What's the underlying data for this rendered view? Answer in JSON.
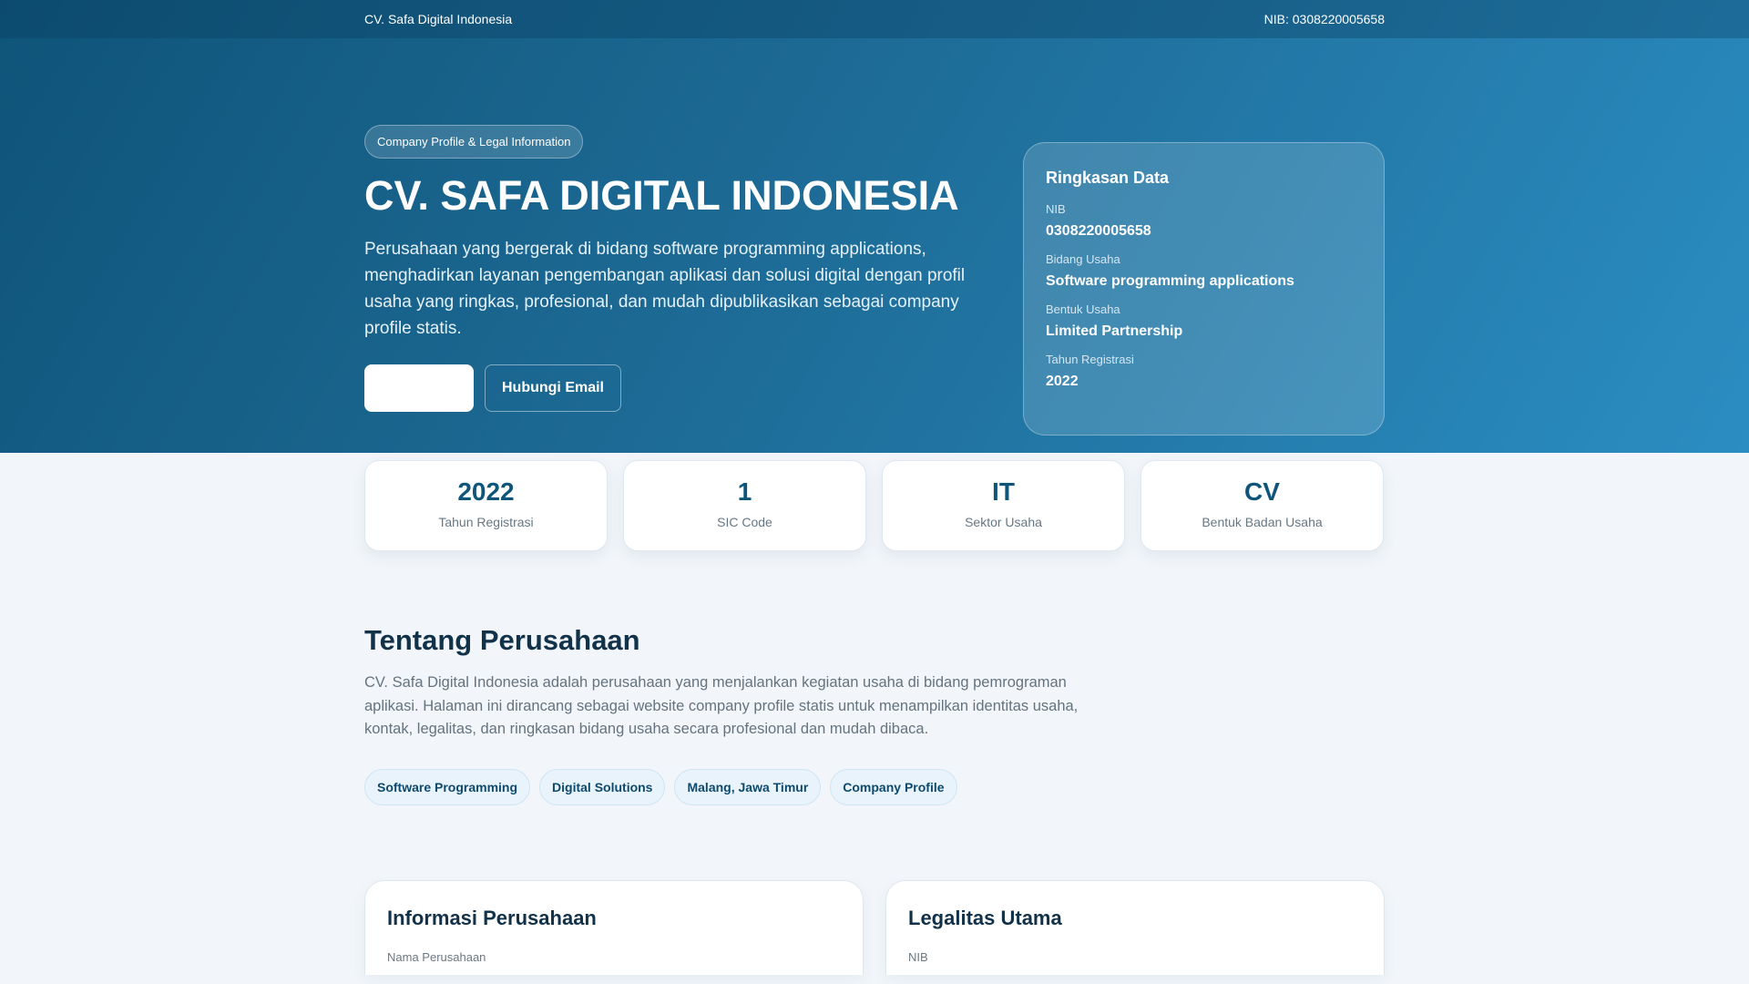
{
  "topbar": {
    "brand": "CV. Safa Digital Indonesia",
    "nib": "NIB: 0308220005658"
  },
  "hero": {
    "badge": "Company Profile & Legal Information",
    "title": "CV. SAFA DIGITAL INDONESIA",
    "description": "Perusahaan yang bergerak di bidang software programming applications, menghadirkan layanan pengembangan aplikasi dan solusi digital dengan profil usaha yang ringkas, profesional, dan mudah dipublikasikan sebagai company profile statis.",
    "primary_button": "",
    "email_button": "Hubungi Email"
  },
  "summary": {
    "title": "Ringkasan Data",
    "items": [
      {
        "label": "NIB",
        "value": "0308220005658"
      },
      {
        "label": "Bidang Usaha",
        "value": "Software programming applications"
      },
      {
        "label": "Bentuk Usaha",
        "value": "Limited Partnership"
      },
      {
        "label": "Tahun Registrasi",
        "value": "2022"
      }
    ]
  },
  "stats": [
    {
      "value": "2022",
      "label": "Tahun Registrasi"
    },
    {
      "value": "1",
      "label": "SIC Code"
    },
    {
      "value": "IT",
      "label": "Sektor Usaha"
    },
    {
      "value": "CV",
      "label": "Bentuk Badan Usaha"
    }
  ],
  "about": {
    "title": "Tentang Perusahaan",
    "text": "CV. Safa Digital Indonesia adalah perusahaan yang menjalankan kegiatan usaha di bidang pemrograman aplikasi. Halaman ini dirancang sebagai website company profile statis untuk menampilkan identitas usaha, kontak, legalitas, dan ringkasan bidang usaha secara profesional dan mudah dibaca.",
    "tags": [
      "Software Programming",
      "Digital Solutions",
      "Malang, Jawa Timur",
      "Company Profile"
    ]
  },
  "cards": [
    {
      "title": "Informasi Perusahaan",
      "first_label": "Nama Perusahaan"
    },
    {
      "title": "Legalitas Utama",
      "first_label": "NIB"
    }
  ]
}
